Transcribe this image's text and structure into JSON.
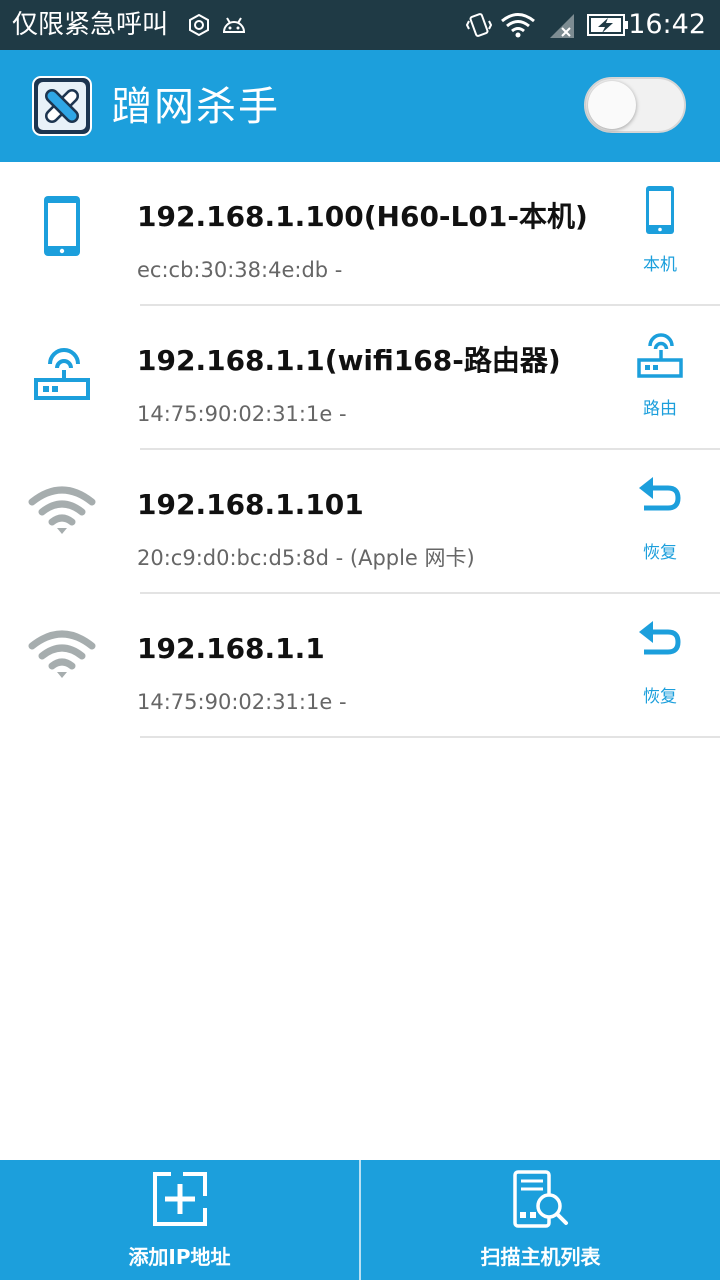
{
  "status_bar": {
    "carrier": "仅限紧急呼叫",
    "time": "16:42",
    "icons": [
      "sync-icon",
      "android-icon",
      "vibrate-icon",
      "wifi-icon",
      "signal-no-sim-icon",
      "battery-charging-icon"
    ]
  },
  "app_bar": {
    "title": "蹭网杀手",
    "logo_icon": "link-logo-icon",
    "toggle_on": false
  },
  "devices": [
    {
      "icon": "phone-icon",
      "title": "192.168.1.100(H60-L01-本机)",
      "subtitle": "ec:cb:30:38:4e:db -",
      "action_icon": "phone-icon",
      "action_label": "本机"
    },
    {
      "icon": "router-icon",
      "title": "192.168.1.1(wifi168-路由器)",
      "subtitle": "14:75:90:02:31:1e -",
      "action_icon": "router-icon",
      "action_label": "路由"
    },
    {
      "icon": "wifi-icon",
      "title": "192.168.1.101",
      "subtitle": "20:c9:d0:bc:d5:8d - (Apple 网卡)",
      "action_icon": "undo-arrow-icon",
      "action_label": "恢复"
    },
    {
      "icon": "wifi-icon",
      "title": "192.168.1.1",
      "subtitle": "14:75:90:02:31:1e -",
      "action_icon": "undo-arrow-icon",
      "action_label": "恢复"
    }
  ],
  "bottom_bar": {
    "add_ip": {
      "label": "添加IP地址",
      "icon": "add-box-icon"
    },
    "scan": {
      "label": "扫描主机列表",
      "icon": "scan-list-icon"
    }
  },
  "colors": {
    "accent": "#1c9fdc",
    "status_bar": "#1f3a45",
    "wifi_gray": "#a6adae",
    "divider": "#e3e3e3"
  }
}
